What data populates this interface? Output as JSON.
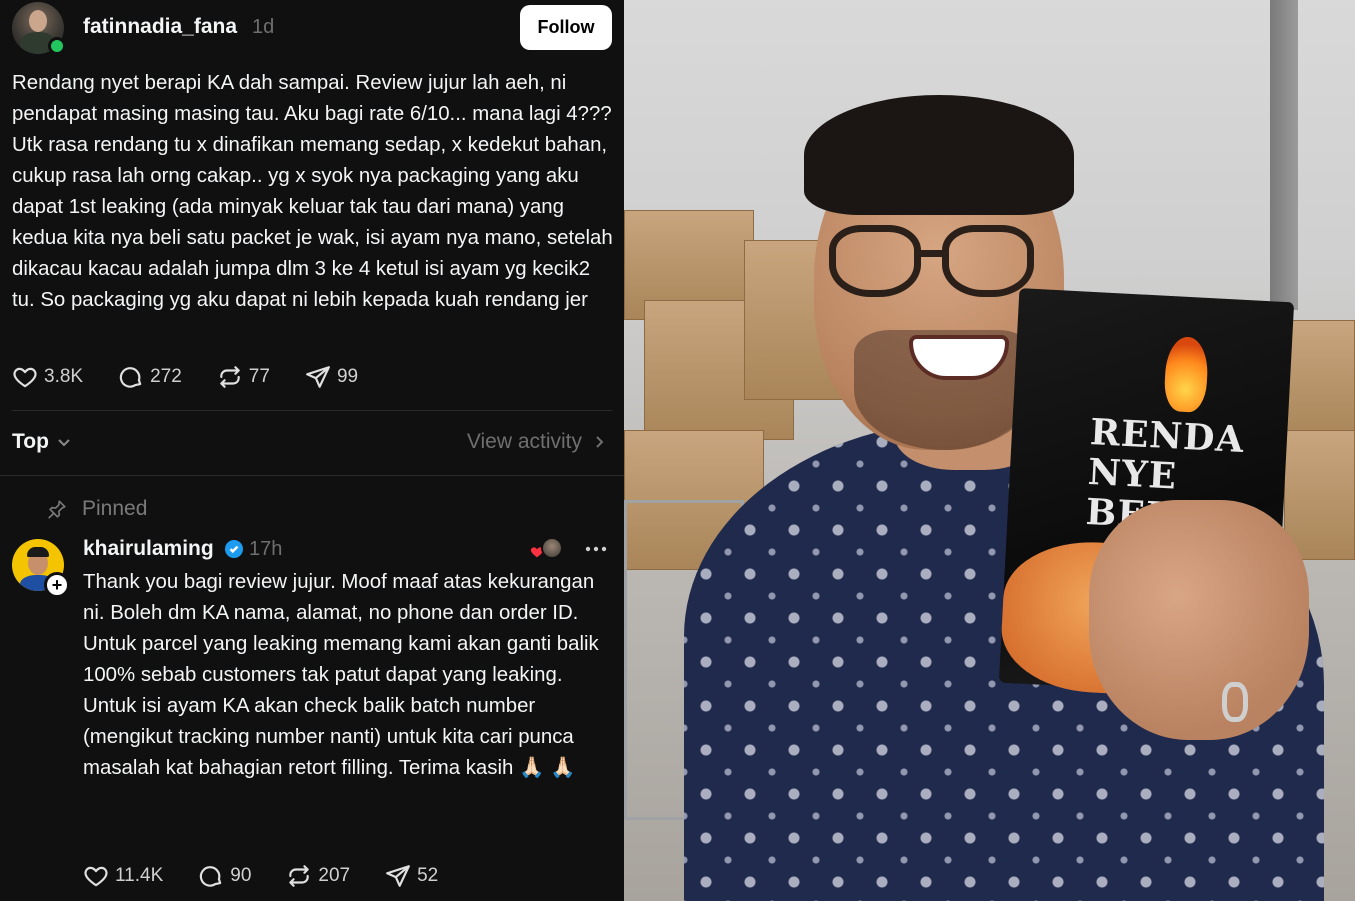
{
  "post": {
    "username": "fatinnadia_fana",
    "time": "1d",
    "follow_label": "Follow",
    "text": "Rendang nyet berapi KA dah sampai. Review jujur lah aeh, ni pendapat masing masing tau. Aku bagi rate 6/10... mana lagi 4??? Utk rasa rendang tu x dinafikan memang sedap, x kedekut bahan, cukup rasa lah orng cakap.. yg x syok nya packaging yang aku dapat 1st leaking (ada minyak keluar tak tau dari mana) yang kedua kita nya beli satu packet je wak, isi ayam nya mano, setelah dikacau kacau adalah jumpa dlm 3 ke 4 ketul isi ayam yg kecik2 tu. So packaging yg aku dapat ni lebih kepada kuah rendang jer",
    "likes": "3.8K",
    "comments": "272",
    "reposts": "77",
    "shares": "99"
  },
  "sort": {
    "label": "Top",
    "view_activity": "View activity"
  },
  "reply": {
    "pinned_label": "Pinned",
    "username": "khairulaming",
    "time": "17h",
    "text": "Thank you bagi review jujur. Moof maaf atas kekurangan ni. Boleh dm KA nama, alamat, no phone dan order ID. Untuk parcel yang leaking memang kami akan ganti balik 100% sebab customers tak patut dapat yang leaking. Untuk isi ayam KA akan check balik batch number (mengikut tracking number nanti) untuk kita cari punca masalah kat bahagian retort filling. Terima kasih 🙏🏻 🙏🏻",
    "likes": "11.4K",
    "comments": "90",
    "reposts": "207",
    "shares": "52"
  },
  "photo": {
    "packet_brand_line1": "RENDA",
    "packet_brand_line2": "NYE",
    "packet_brand_line3": "BER",
    "colors": {
      "verified": "#1d9bf0",
      "online": "#22c55e",
      "background": "#101010"
    }
  }
}
